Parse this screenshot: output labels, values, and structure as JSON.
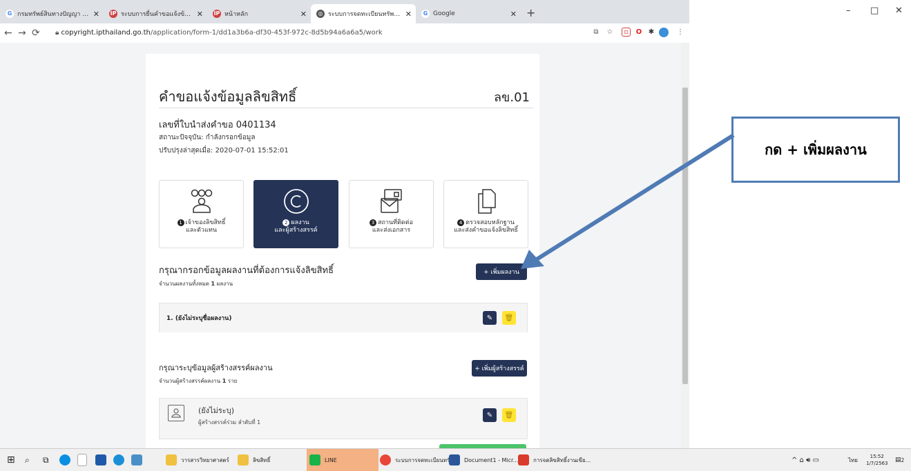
{
  "browser": {
    "tabs": [
      {
        "title": "กรมทรัพย์สินทางปัญญา - ค้นหาด้วย",
        "favicon": "G",
        "color": "#4285f4"
      },
      {
        "title": "ระบบการยื่นคำขอแจ้งข้อมูลลิขสิทธิ์",
        "favicon": "IP",
        "color": "#d04040"
      },
      {
        "title": "หน้าหลัก",
        "favicon": "IP",
        "color": "#d04040"
      },
      {
        "title": "ระบบการจดทะเบียนทรัพย์สินทางปัญญ",
        "favicon": "◎",
        "color": "#444"
      },
      {
        "title": "Google",
        "favicon": "G",
        "color": "#4285f4"
      }
    ],
    "url_domain": "copyright.ipthailand.go.th",
    "url_path": "/application/form-1/dd1a3b6a-df30-453f-972c-8d5b94a6a6a5/work",
    "window_controls": [
      "–",
      "□",
      "✕"
    ]
  },
  "form": {
    "title": "คำขอแจ้งข้อมูลลิขสิทธิ์",
    "code": "ลข.01",
    "submission_no": "เลขที่ใบนำส่งคำขอ 0401134",
    "status": "สถานะปัจจุบัน: กำลังกรอกข้อมูล",
    "updated": "ปรับปรุงล่าสุดเมื่อ: 2020-07-01 15:52:01"
  },
  "steps": [
    {
      "num": "1",
      "line1": "เจ้าของลิขสิทธิ์",
      "line2": "และตัวแทน",
      "icon": "people-icon",
      "active": false
    },
    {
      "num": "2",
      "line1": "ผลงาน",
      "line2": "และผู้สร้างสรรค์",
      "icon": "copyright-icon",
      "active": true
    },
    {
      "num": "3",
      "line1": "สถานที่ติดต่อ",
      "line2": "และส่งเอกสาร",
      "icon": "mail-icon",
      "active": false
    },
    {
      "num": "4",
      "line1": "ตรวจสอบหลักฐาน",
      "line2": "และส่งคำขอแจ้งลิขสิทธิ์",
      "icon": "documents-icon",
      "active": false
    }
  ],
  "works": {
    "heading": "กรุณากรอกข้อมูลผลงานที่ต้องการแจ้งลิขสิทธิ์",
    "count_prefix": "จำนวนผลงานทั้งหมด ",
    "count": "1",
    "count_suffix": " ผลงาน",
    "add_label": "+ เพิ่มผลงาน",
    "items": [
      {
        "label": "1. (ยังไม่ระบุชื่อผลงาน)"
      }
    ]
  },
  "creators": {
    "heading": "กรุณาระบุข้อมูลผู้สร้างสรรค์ผลงาน",
    "count_prefix": "จำนวนผู้สร้างสรรค์ผลงาน ",
    "count": "1",
    "count_suffix": " ราย",
    "add_label": "+ เพิ่มผู้สร้างสรรค์",
    "items": [
      {
        "name": "(ยังไม่ระบุ)",
        "role": "ผู้สร้างสรรค์ร่วม ลำดับที่ 1"
      }
    ]
  },
  "annotation": {
    "text": "กด + เพิ่มผลงาน",
    "color": "#4f7bb5"
  },
  "taskbar": {
    "items": [
      "วารสารวิทยาศาสตร์",
      "ลิขสิทธิ์",
      "LINE",
      "ระบบการจดทะเบียนทรั...",
      "Document1 - Micr...",
      "การจดลิขสิทธิ์งานเขีย..."
    ],
    "clock_time": "15:52",
    "clock_date": "1/7/2563",
    "lang": "ไทย",
    "notif_count": "2"
  }
}
